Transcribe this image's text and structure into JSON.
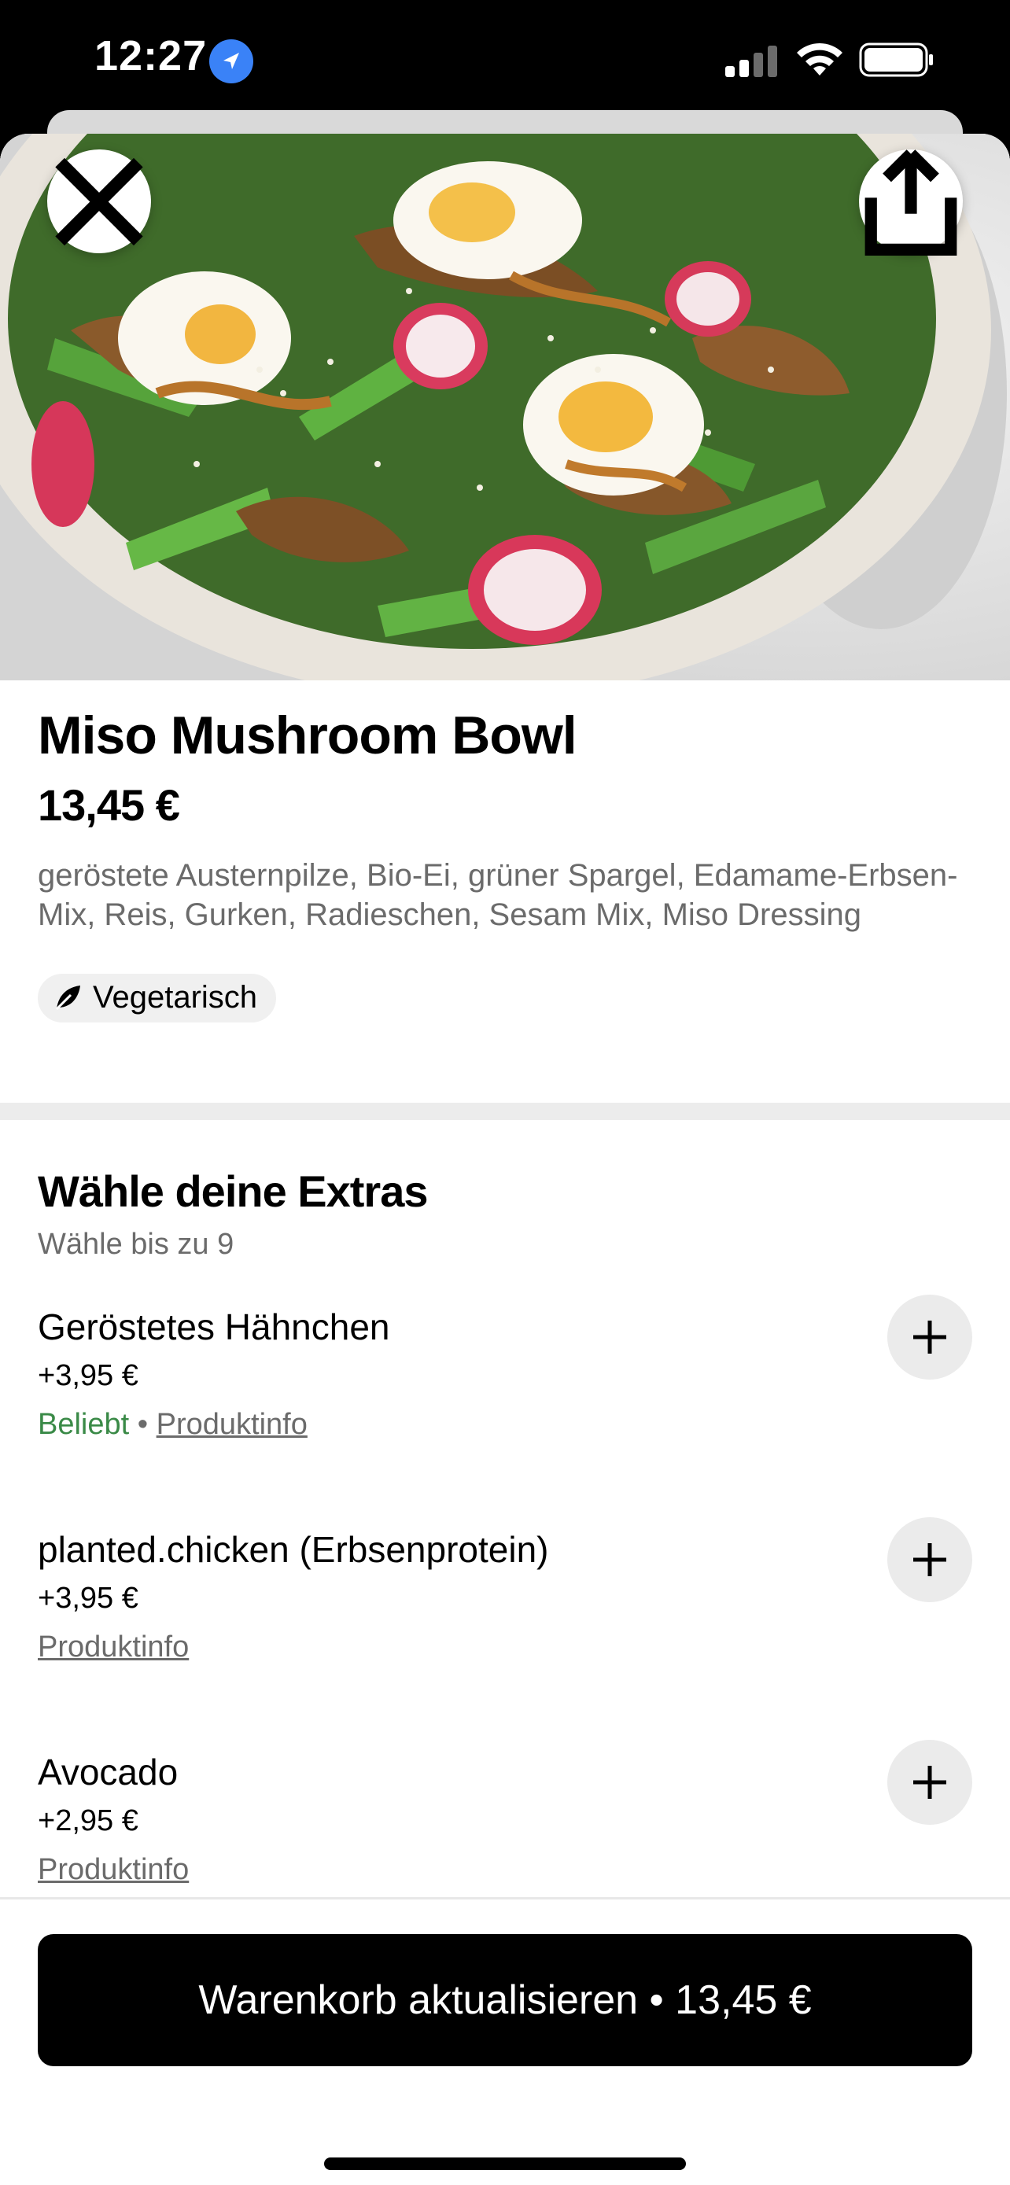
{
  "status_bar": {
    "time": "12:27",
    "icons": [
      "location-arrow-icon",
      "cellular-signal-icon",
      "wifi-icon",
      "battery-icon"
    ]
  },
  "header": {
    "close_icon": "close-icon",
    "share_icon": "share-icon"
  },
  "item": {
    "title": "Miso Mushroom Bowl",
    "price": "13,45 €",
    "description": "geröstete Austernpilze, Bio-Ei, grüner Spargel, Edamame-Erbsen-Mix, Reis, Gurken, Radieschen, Sesam Mix, Miso Dressing",
    "tag": "Vegetarisch",
    "tag_icon": "leaf-icon"
  },
  "extras": {
    "title": "Wähle deine Extras",
    "subtitle": "Wähle bis zu 9",
    "options": [
      {
        "name": "Geröstetes Hähnchen",
        "price": "+3,95 €",
        "popular": "Beliebt",
        "separator": "•",
        "info": "Produktinfo"
      },
      {
        "name": "planted.chicken (Erbsenprotein)",
        "price": "+3,95 €",
        "info": "Produktinfo"
      },
      {
        "name": "Avocado",
        "price": "+2,95 €",
        "info": "Produktinfo"
      }
    ]
  },
  "cta": {
    "label": "Warenkorb aktualisieren • 13,45 €"
  },
  "colors": {
    "accent_green": "#3a8a47",
    "location_blue": "#3a82f7",
    "cta_bg": "#000000"
  }
}
